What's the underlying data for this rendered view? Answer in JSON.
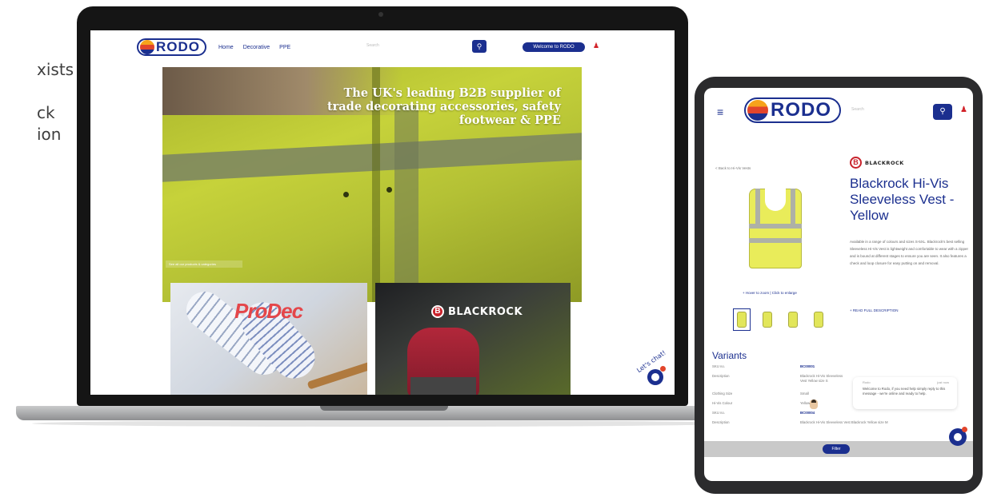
{
  "intro": {
    "line1": "xists",
    "line2": "ck",
    "line3": "ion"
  },
  "brand": {
    "name": "RODO",
    "primary_color": "#1b2f8f",
    "accent_red": "#e2452b",
    "accent_yellow": "#f6a31b"
  },
  "laptop": {
    "nav": {
      "links": [
        "Home",
        "Decorative",
        "PPE"
      ],
      "search_placeholder": "Search",
      "search_icon": "search-icon",
      "welcome_label": "Welcome to RODO",
      "user_icon": "user-icon"
    },
    "hero": {
      "title": "The UK's leading B2B supplier of trade decorating accessories, safety footwear & PPE",
      "cta": "See all our products & categories"
    },
    "promos": [
      {
        "brand": "ProDec"
      },
      {
        "brand": "BLACKROCK",
        "badge": "B"
      }
    ],
    "chat": {
      "label": "Let's chat!",
      "icon": "chat-icon"
    }
  },
  "tablet": {
    "nav": {
      "menu_icon": "hamburger-menu-icon",
      "search_placeholder": "Search",
      "search_icon": "search-icon",
      "user_icon": "user-icon"
    },
    "back_link": "< Back to Hi-Vis Vests",
    "product": {
      "brand_badge": "B",
      "brand": "BLACKROCK",
      "title": "Blackrock Hi-Vis Sleeveless Vest - Yellow",
      "description": "Available in a range of colours and sizes S-5XL. Blackrock's best selling Sleeveless Hi-Vis Vest is lightweight and comfortable to wear with a zipper and is bound at different stages to ensure you are seen. It also features a check and loop closure for easy putting on and removal.",
      "more_link": "+ READ FULL DESCRIPTION",
      "zoom_hint": "+ Hover to zoom | Click to enlarge"
    },
    "variants_title": "Variants",
    "variant_rows": [
      {
        "label": "SKU no.",
        "value": "BC00001"
      },
      {
        "label": "Description",
        "value": "Blackrock Hi-Vis Sleeveless Vest Yellow size S"
      },
      {
        "label": "Clothing Size",
        "value": "Small"
      },
      {
        "label": "Hi-Vis Colour",
        "value": "Yellow"
      },
      {
        "label": "SKU no.",
        "value": "BC00004"
      },
      {
        "label": "Description",
        "value": "Blackrock Hi-Vis Sleeveless Vest Blackrock Yellow size M"
      }
    ],
    "chat": {
      "agent": "Rodo",
      "time": "just now",
      "message": "Welcome to Rodo, if you need help simply reply to this message - we're online and ready to help."
    },
    "filter_label": "Filter"
  }
}
